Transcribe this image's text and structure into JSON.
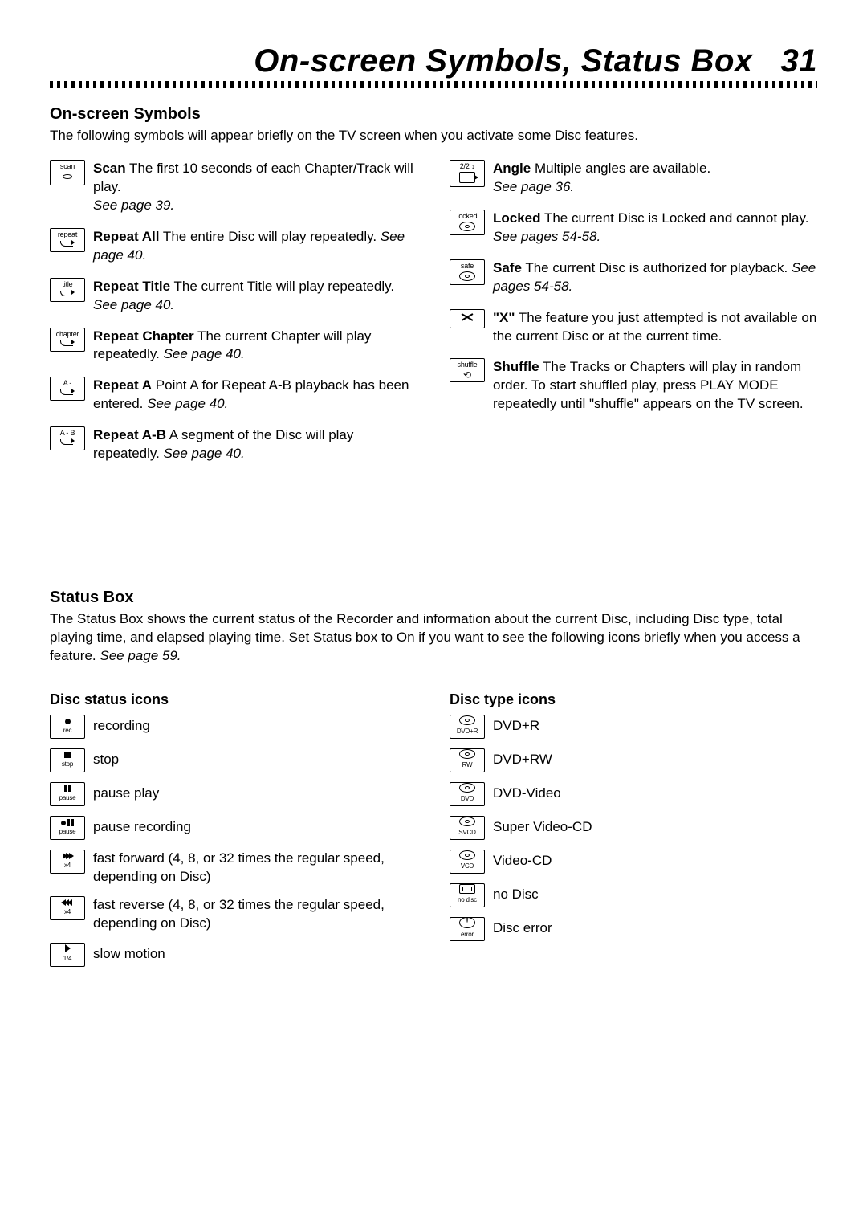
{
  "page": {
    "title_prefix": "On-screen Symbols, Status Box",
    "page_number": "31"
  },
  "onscreen": {
    "heading": "On-screen Symbols",
    "intro": "The following symbols will appear briefly on the TV screen when you activate some Disc features.",
    "left": [
      {
        "icon_label": "scan",
        "title": "Scan",
        "body": " The first 10 seconds of each Chapter/Track will play. ",
        "see": "See page 39."
      },
      {
        "icon_label": "repeat",
        "title": "Repeat All",
        "body": " The entire Disc will play repeatedly. ",
        "see": "See page 40."
      },
      {
        "icon_label": "title",
        "title": "Repeat Title",
        "body": " The current Title will play repeatedly. ",
        "see": "See page 40."
      },
      {
        "icon_label": "chapter",
        "title": "Repeat Chapter",
        "body": " The current Chapter will play repeatedly. ",
        "see": "See page 40."
      },
      {
        "icon_label": "A -",
        "title": "Repeat A",
        "body": "  Point A for Repeat A-B playback has been entered. ",
        "see": "See page 40."
      },
      {
        "icon_label": "A - B",
        "title": "Repeat A-B",
        "body": " A segment of the Disc will play repeatedly. ",
        "see": "See page 40."
      }
    ],
    "right": [
      {
        "icon_label": "2/2 ↕",
        "title": "Angle",
        "body": " Multiple angles are available. ",
        "see": "See page 36."
      },
      {
        "icon_label": "locked",
        "title": "Locked",
        "body": " The current Disc is Locked and cannot play. ",
        "see": "See pages 54-58."
      },
      {
        "icon_label": "safe",
        "title": "Safe",
        "body": " The current Disc is authorized for playback. ",
        "see": "See pages 54-58."
      },
      {
        "icon_label": "",
        "title": "\"X\"",
        "body": " The feature you just attempted is not available on the current Disc or at the current time.",
        "see": ""
      },
      {
        "icon_label": "shuffle",
        "title": "Shuffle",
        "body": " The Tracks or Chapters will play in random order.  To start shuffled play, press PLAY MODE repeatedly until \"shuffle\" appears on the TV screen.",
        "see": ""
      }
    ]
  },
  "statusbox": {
    "heading": "Status Box",
    "intro": "The Status Box shows the current status of the Recorder and information about the current Disc, including Disc type, total playing time, and elapsed playing time. Set Status box to On if you want to see the following icons briefly when you access a feature. ",
    "intro_see": "See page 59.",
    "disc_status_h": "Disc status icons",
    "disc_type_h": "Disc type icons",
    "disc_status": [
      {
        "icon_label": "rec",
        "text": "recording"
      },
      {
        "icon_label": "stop",
        "text": "stop"
      },
      {
        "icon_label": "pause",
        "text": "pause play"
      },
      {
        "icon_label": "pause",
        "text": "pause recording"
      },
      {
        "icon_label": "x4",
        "text": "fast forward (4, 8, or 32 times the regular speed, depending on Disc)"
      },
      {
        "icon_label": "x4",
        "text": "fast reverse (4, 8, or 32 times the regular speed, depending on Disc)"
      },
      {
        "icon_label": "1/4",
        "text": "slow motion"
      }
    ],
    "disc_type": [
      {
        "icon_label": "DVD+R",
        "text": "DVD+R"
      },
      {
        "icon_label": "RW",
        "text": "DVD+RW"
      },
      {
        "icon_label": "DVD",
        "text": "DVD-Video"
      },
      {
        "icon_label": "SVCD",
        "text": "Super Video-CD"
      },
      {
        "icon_label": "VCD",
        "text": "Video-CD"
      },
      {
        "icon_label": "no disc",
        "text": "no Disc"
      },
      {
        "icon_label": "error",
        "text": "Disc error"
      }
    ]
  }
}
